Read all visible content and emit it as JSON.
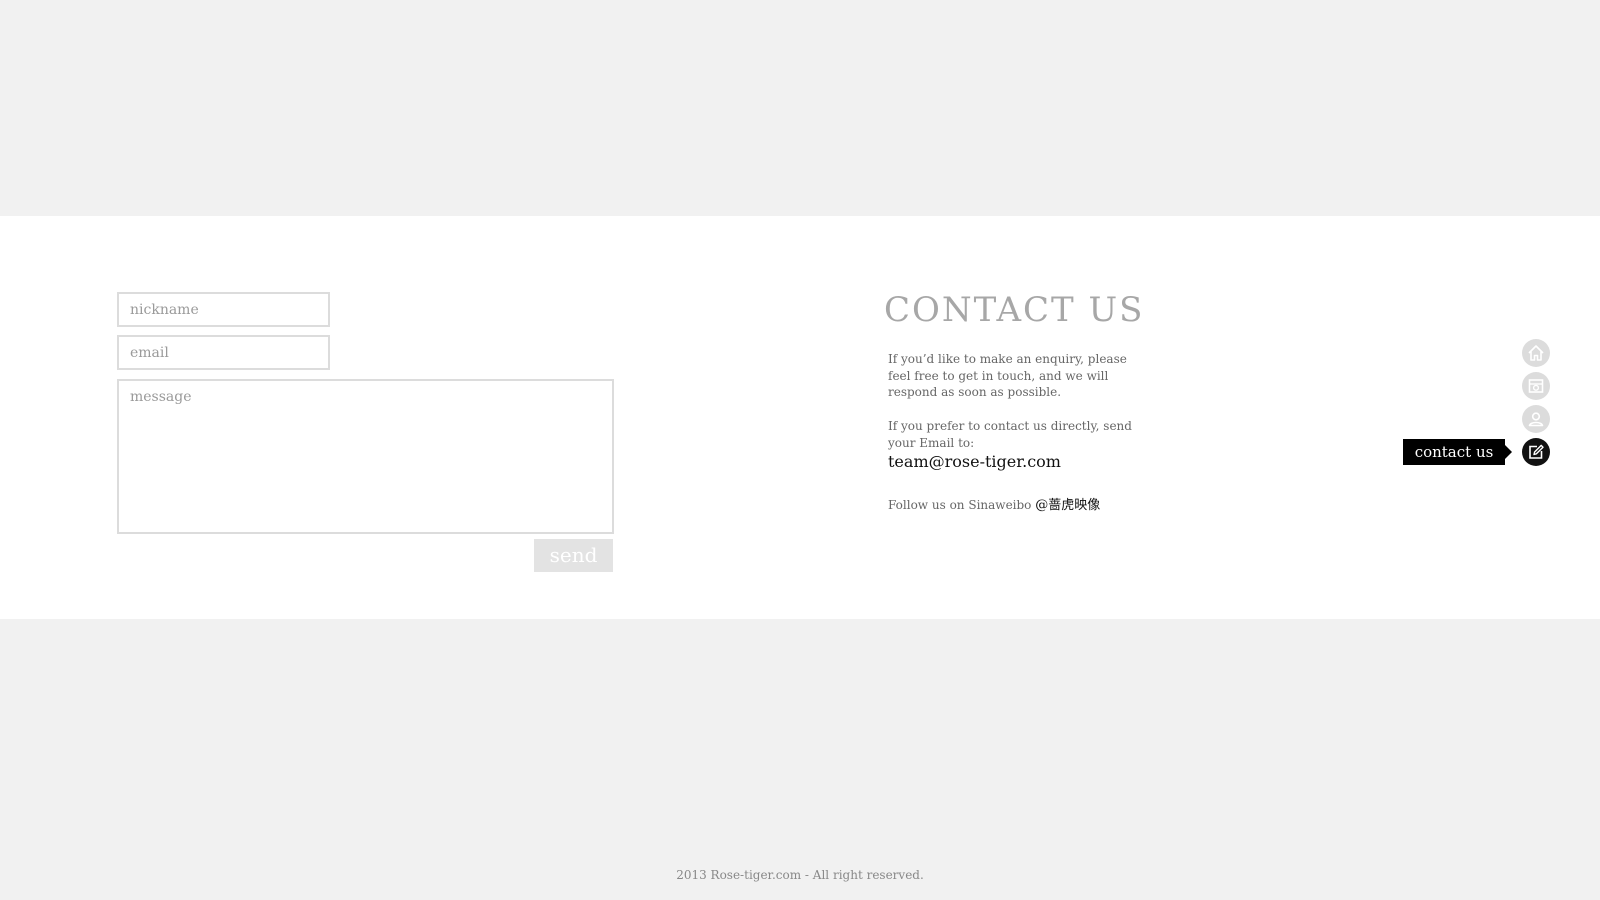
{
  "form": {
    "nickname_placeholder": "nickname",
    "email_placeholder": "email",
    "message_placeholder": "message",
    "send_label": "send"
  },
  "contact": {
    "title": "CONTACT US",
    "paragraph1": "If you’d like to make an enquiry, please feel free to get in touch, and we will respond as soon as possible.",
    "paragraph2": "If you prefer to contact us directly, send your Email to:",
    "email": "team@rose-tiger.com",
    "follow_prefix": "Follow us on Sinaweibo ",
    "weibo_handle": "@蔷虎映像"
  },
  "nav": {
    "items": [
      {
        "icon": "home-icon",
        "active": false
      },
      {
        "icon": "gallery-icon",
        "active": false
      },
      {
        "icon": "user-icon",
        "active": false
      },
      {
        "icon": "edit-icon",
        "active": true
      }
    ],
    "tooltip": "contact us"
  },
  "footer": {
    "text": "2013 Rose-tiger.com - All right reserved."
  },
  "colors": {
    "background": "#f1f1f1",
    "content_background": "#ffffff",
    "active_icon": "#111111",
    "inactive_icon": "#dcdcdc"
  }
}
